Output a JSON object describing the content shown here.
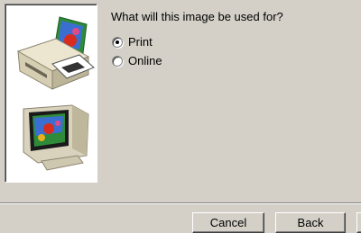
{
  "question": "What will this image be used for?",
  "options": [
    {
      "label": "Print",
      "selected": true
    },
    {
      "label": "Online",
      "selected": false
    }
  ],
  "buttons": {
    "cancel_label": "Cancel",
    "back_label": "Back"
  },
  "illustrations": [
    "printer-icon",
    "monitor-icon"
  ],
  "colors": {
    "dialog_bg": "#d4d0c8",
    "panel_bg": "#ffffff"
  }
}
